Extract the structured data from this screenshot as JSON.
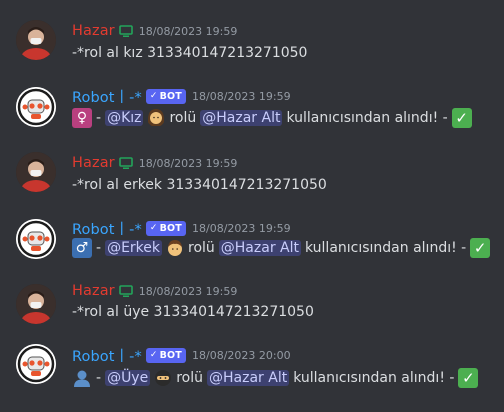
{
  "messages": [
    {
      "author": "Hazar",
      "is_bot": false,
      "timestamp": "18/08/2023 19:59",
      "text": "-*rol al kız 313340147213271050"
    },
    {
      "author": "Robot丨-*",
      "is_bot": true,
      "bot_tag": "BOT",
      "timestamp": "18/08/2023 19:59",
      "role_icon": "female-sign-icon",
      "dash1": "-",
      "role_mention": "@Kız",
      "role_emoji": "woman-face-icon",
      "mid_text": "rolü",
      "user_mention": "@Hazar Alt",
      "tail_text": "kullanıcısından alındı! -",
      "status_icon": "check-mark-icon"
    },
    {
      "author": "Hazar",
      "is_bot": false,
      "timestamp": "18/08/2023 19:59",
      "text": "-*rol al erkek 313340147213271050"
    },
    {
      "author": "Robot丨-*",
      "is_bot": true,
      "bot_tag": "BOT",
      "timestamp": "18/08/2023 19:59",
      "role_icon": "male-sign-icon",
      "dash1": "-",
      "role_mention": "@Erkek",
      "role_emoji": "man-face-icon",
      "mid_text": "rolü",
      "user_mention": "@Hazar Alt",
      "tail_text": "kullanıcısından alındı! -",
      "status_icon": "check-mark-icon"
    },
    {
      "author": "Hazar",
      "is_bot": false,
      "timestamp": "18/08/2023 19:59",
      "text": "-*rol al üye 313340147213271050"
    },
    {
      "author": "Robot丨-*",
      "is_bot": true,
      "bot_tag": "BOT",
      "timestamp": "18/08/2023 20:00",
      "role_icon": "bust-silhouette-icon",
      "dash1": "-",
      "role_mention": "@Üye",
      "role_emoji": "ninja-icon",
      "mid_text": "rolü",
      "user_mention": "@Hazar Alt",
      "tail_text": "kullanıcısından alındı! -",
      "status_icon": "check-mark-icon"
    }
  ],
  "colors": {
    "background": "#313338",
    "user_name": "#e23b30",
    "bot_name": "#3aa6ff",
    "bot_tag": "#5865f2",
    "mention_bg": "#5865f24d",
    "timestamp": "#949ba4",
    "online_monitor": "#23a55a"
  }
}
